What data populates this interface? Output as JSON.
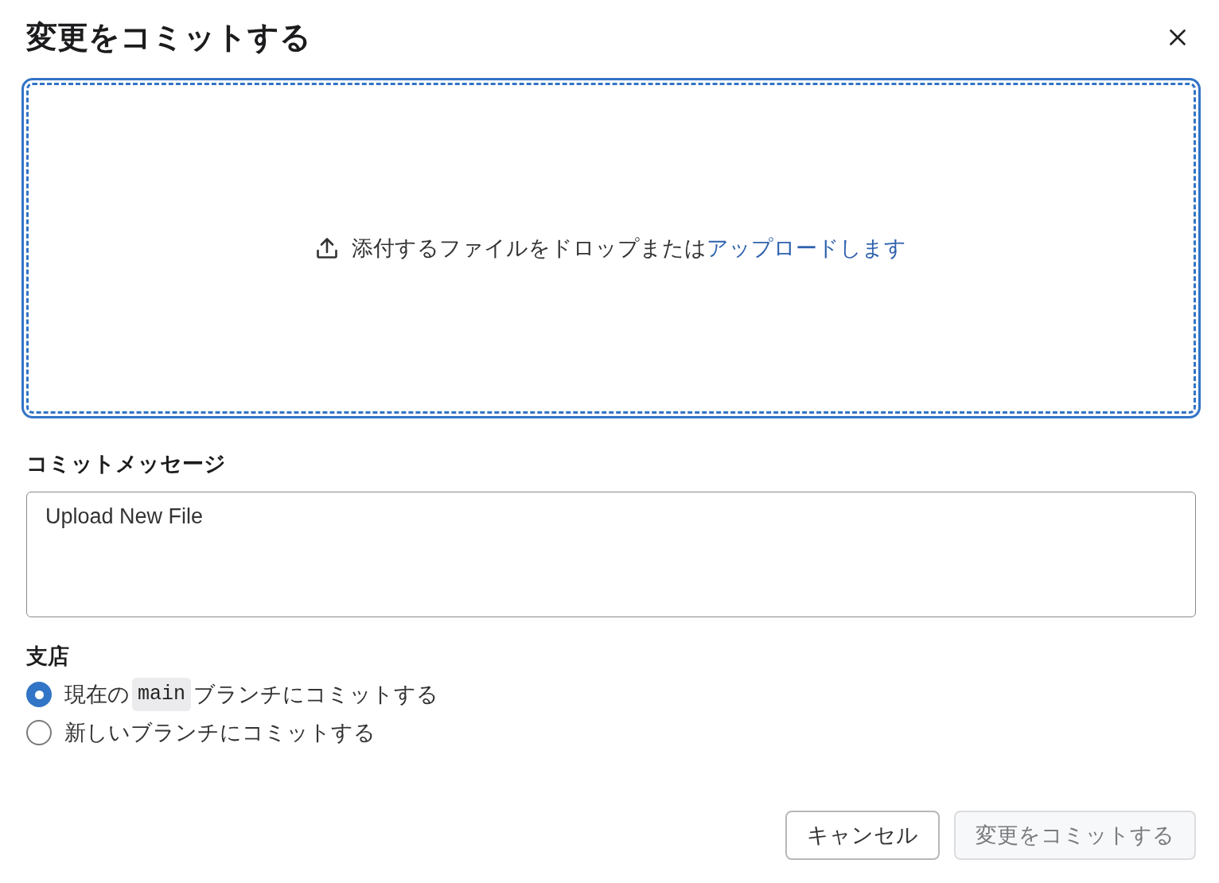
{
  "dialog": {
    "title": "変更をコミットする"
  },
  "dropzone": {
    "focused": true,
    "instruction": "添付するファイルをドロップまたは",
    "link": "アップロードします"
  },
  "commit_message": {
    "label": "コミットメッセージ",
    "value": "Upload New File"
  },
  "branch": {
    "label": "支店",
    "options": [
      {
        "selected": true,
        "parts": [
          {
            "kind": "text",
            "text": "現在の"
          },
          {
            "kind": "code",
            "text": "main"
          },
          {
            "kind": "text",
            "text": "ブランチにコミットする"
          }
        ]
      },
      {
        "selected": false,
        "parts": [
          {
            "kind": "text",
            "text": "新しいブランチにコミットする"
          }
        ]
      }
    ]
  },
  "buttons": [
    {
      "label": "キャンセル",
      "kind": "secondary",
      "disabled": false
    },
    {
      "label": "変更をコミットする",
      "kind": "primary",
      "disabled": true
    }
  ]
}
